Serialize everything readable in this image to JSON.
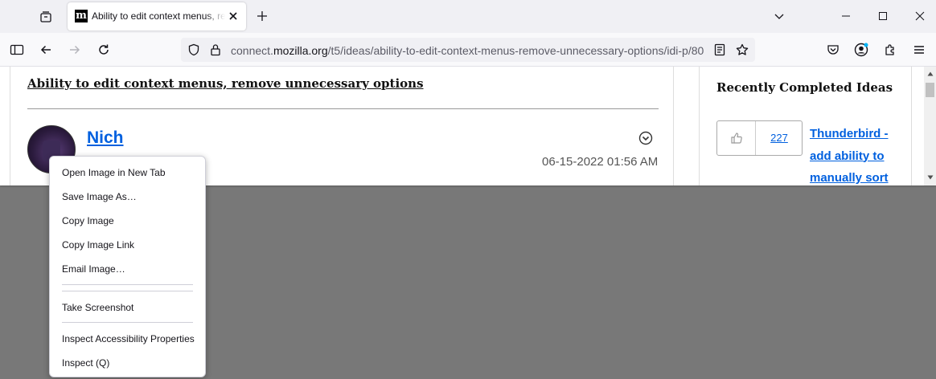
{
  "browser": {
    "tab": {
      "title": "Ability to edit context menus, remove unnecessary options",
      "favicon_letter": "m"
    },
    "url": {
      "domain_prefix": "connect.",
      "domain": "mozilla.org",
      "path": "/t5/ideas/ability-to-edit-context-menus-remove-unnecessary-options/idi-p/80"
    },
    "icons": {
      "tab_list": "tab-list-icon",
      "close_tab": "close-icon",
      "new_tab": "plus-icon",
      "list_all_tabs": "chevron-down-icon",
      "minimize": "minimize-icon",
      "maximize": "maximize-icon",
      "close_window": "close-icon",
      "sidebar": "sidebar-icon",
      "back": "back-arrow-icon",
      "forward": "forward-arrow-icon",
      "reload": "reload-icon",
      "tracking_protection": "shield-icon",
      "site_security": "lock-icon",
      "reader_view": "reader-view-icon",
      "bookmark": "star-icon",
      "pocket": "pocket-icon",
      "account": "account-icon",
      "extensions": "puzzle-icon",
      "menu": "hamburger-menu-icon"
    }
  },
  "page": {
    "post_title": "Ability to edit context menus, remove unnecessary options",
    "author": "Nich",
    "date": "06-15-2022 01:56 AM",
    "sidebar": {
      "title": "Recently Completed Ideas",
      "kudos_count": "227",
      "idea_link": "Thunderbird - add ability to manually sort"
    }
  },
  "context_menu": {
    "items": [
      "Open Image in New Tab",
      "Save Image As…",
      "Copy Image",
      "Copy Image Link",
      "Email Image…",
      "Take Screenshot",
      "Inspect Accessibility Properties",
      "Inspect (Q)"
    ]
  },
  "colors": {
    "link": "#0060df",
    "tabstrip": "#f0f0f4",
    "navbar": "#f9f9fb",
    "backdrop": "#787878"
  }
}
